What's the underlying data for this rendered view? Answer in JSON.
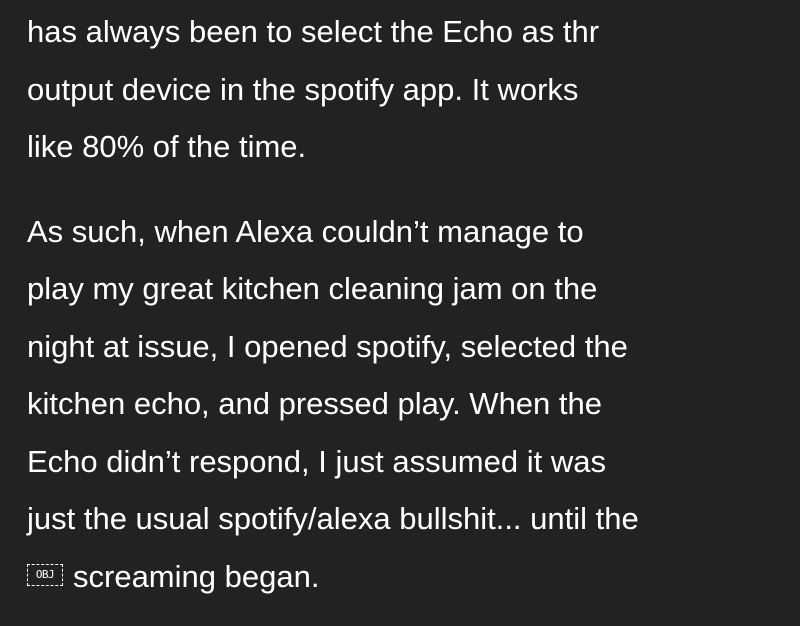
{
  "post": {
    "paragraph_1": {
      "lines": [
        "has always been to select the Echo as thr",
        "output device in the spotify app. It works",
        "like 80% of the time."
      ]
    },
    "paragraph_2": {
      "lines": [
        "As such, when Alexa couldn’t manage to",
        "play my great kitchen cleaning jam on the",
        "night at issue, I opened spotify, selected the",
        "kitchen echo, and pressed play. When the",
        "Echo didn’t respond, I just assumed it was",
        "just the usual spotify/alexa bullshit... until the"
      ],
      "last_line": {
        "icon": "object-replacement-icon",
        "icon_label": "OBJ",
        "text": "screaming began."
      }
    }
  }
}
